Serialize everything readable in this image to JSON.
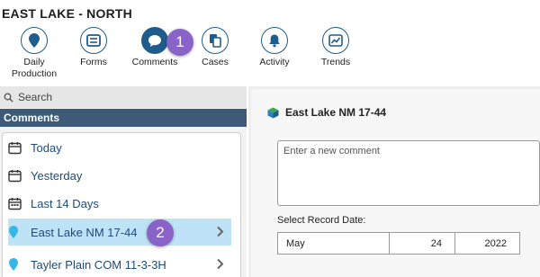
{
  "app": {
    "title": "EAST LAKE - NORTH"
  },
  "toolbar": {
    "items": [
      {
        "label": "Daily\nProduction",
        "icon": "map-pin-icon"
      },
      {
        "label": "Forms",
        "icon": "form-icon"
      },
      {
        "label": "Comments",
        "icon": "chat-bubble-icon",
        "active": true
      },
      {
        "label": "Cases",
        "icon": "copy-icon"
      },
      {
        "label": "Activity",
        "icon": "bell-icon"
      },
      {
        "label": "Trends",
        "icon": "line-chart-icon"
      }
    ]
  },
  "badges": {
    "one": "1",
    "two": "2"
  },
  "sidebar": {
    "search_placeholder": "Search",
    "section_title": "Comments",
    "items": [
      {
        "label": "Today",
        "icon": "calendar-icon"
      },
      {
        "label": "Yesterday",
        "icon": "calendar-icon"
      },
      {
        "label": "Last 14 Days",
        "icon": "calendar-grid-icon"
      },
      {
        "label": "East Lake NM 17-44",
        "icon": "map-pin-icon",
        "selected": true
      },
      {
        "label": "Tayler Plain COM 11-3-3H",
        "icon": "map-pin-icon"
      }
    ]
  },
  "main": {
    "record_title": "East Lake NM 17-44",
    "comment_placeholder": "Enter a new comment",
    "date_label": "Select Record Date:",
    "date": {
      "month": "May",
      "day": "24",
      "year": "2022"
    }
  },
  "colors": {
    "accent": "#1f5c8b",
    "header": "#3d5a79",
    "selected": "#bfe3f6",
    "badge": "#8a63c9",
    "pin": "#39b6e8"
  }
}
